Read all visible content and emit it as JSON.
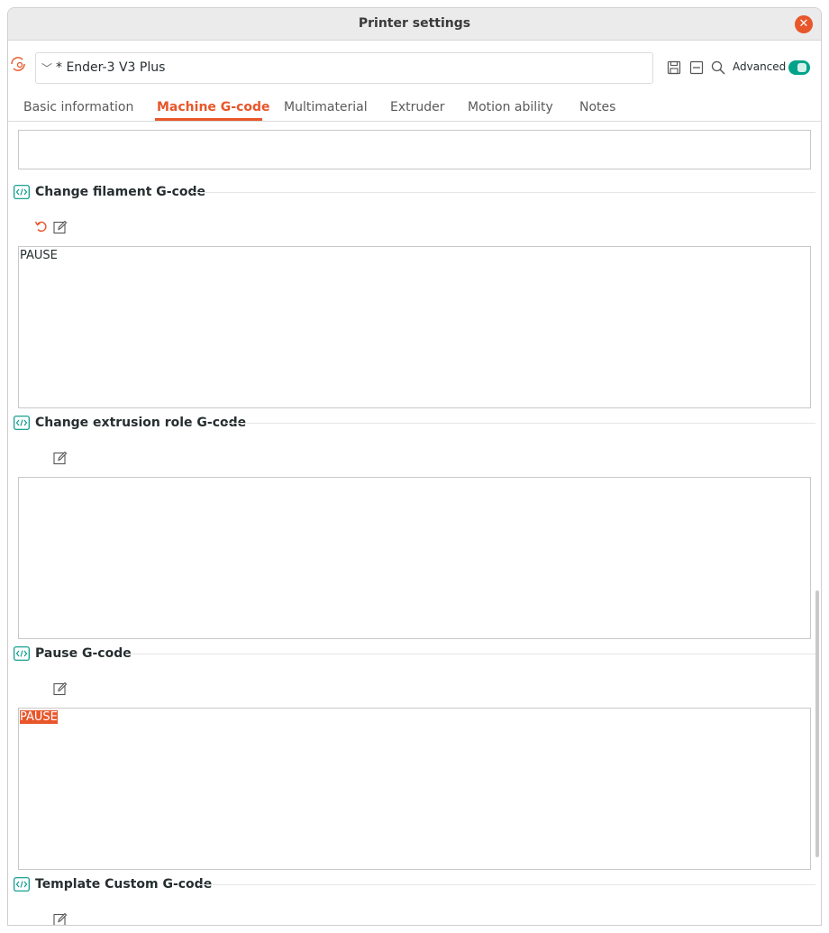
{
  "window": {
    "title": "Printer settings"
  },
  "toolbar": {
    "preset_value": "* Ender-3 V3 Plus",
    "advanced_label": "Advanced",
    "advanced_enabled": true
  },
  "tabs": [
    {
      "label": "Basic information",
      "active": false
    },
    {
      "label": "Machine G-code",
      "active": true
    },
    {
      "label": "Multimaterial",
      "active": false
    },
    {
      "label": "Extruder",
      "active": false
    },
    {
      "label": "Motion ability",
      "active": false
    },
    {
      "label": "Notes",
      "active": false
    }
  ],
  "sections": {
    "change_filament": {
      "title": "Change filament G-code",
      "value": "PAUSE"
    },
    "change_extrusion_role": {
      "title": "Change extrusion role G-code",
      "value": ""
    },
    "pause": {
      "title": "Pause G-code",
      "value": "PAUSE"
    },
    "template_custom": {
      "title": "Template Custom G-code"
    }
  },
  "colors": {
    "accent": "#e8562a",
    "toggle_on": "#00a38a",
    "icon_teal": "#009688"
  },
  "icons": [
    "sync-icon",
    "close-icon",
    "chevron-down-icon",
    "save-icon",
    "delete-icon",
    "search-icon",
    "gcode-icon",
    "reset-icon",
    "edit-icon"
  ]
}
